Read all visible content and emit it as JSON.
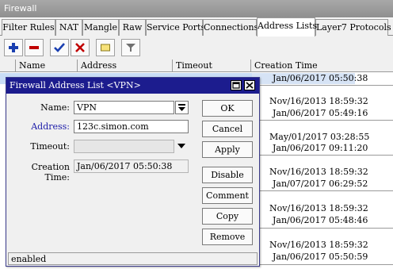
{
  "window": {
    "title": "Firewall"
  },
  "tabs": [
    {
      "label": "Filter Rules"
    },
    {
      "label": "NAT"
    },
    {
      "label": "Mangle"
    },
    {
      "label": "Raw"
    },
    {
      "label": "Service Ports"
    },
    {
      "label": "Connections"
    },
    {
      "label": "Address Lists"
    },
    {
      "label": "Layer7 Protocols"
    }
  ],
  "toolbar": {
    "add_icon": "plus-icon",
    "remove_icon": "minus-icon",
    "enable_icon": "check-icon",
    "disable_icon": "cross-icon",
    "comment_icon": "note-icon",
    "filter_icon": "funnel-icon"
  },
  "table": {
    "columns": [
      "Name",
      "Address",
      "Timeout",
      "Creation Time"
    ],
    "selected_row_time": "Jan/06/2017 05:50:38",
    "creation_times": [
      "Nov/16/2013 18:59:32",
      "Jan/06/2017 05:49:16",
      "May/01/2017 03:28:55",
      "Jan/06/2017 09:11:20",
      "Nov/16/2013 18:59:32",
      "Jan/07/2017 06:29:52",
      "Nov/16/2013 18:59:32",
      "Jan/06/2017 05:48:46",
      "Nov/16/2013 18:59:32",
      "Jan/06/2017 05:50:59"
    ]
  },
  "dialog": {
    "title": "Firewall Address List <VPN>",
    "name_label": "Name:",
    "name_value": "VPN",
    "address_label": "Address:",
    "address_value": "123c.simon.com",
    "timeout_label": "Timeout:",
    "timeout_value": "",
    "creation_label": "Creation Time:",
    "creation_value": "Jan/06/2017 05:50:38",
    "buttons": {
      "ok": "OK",
      "cancel": "Cancel",
      "apply": "Apply",
      "disable": "Disable",
      "comment": "Comment",
      "copy": "Copy",
      "remove": "Remove"
    },
    "status": "enabled"
  },
  "colors": {
    "dialog_title_bg": "#1c1c8e",
    "address_label": "#1a1aa8",
    "add_icon": "#1a3fb0",
    "remove_icon": "#c00000",
    "check_icon": "#1a3fb0"
  }
}
